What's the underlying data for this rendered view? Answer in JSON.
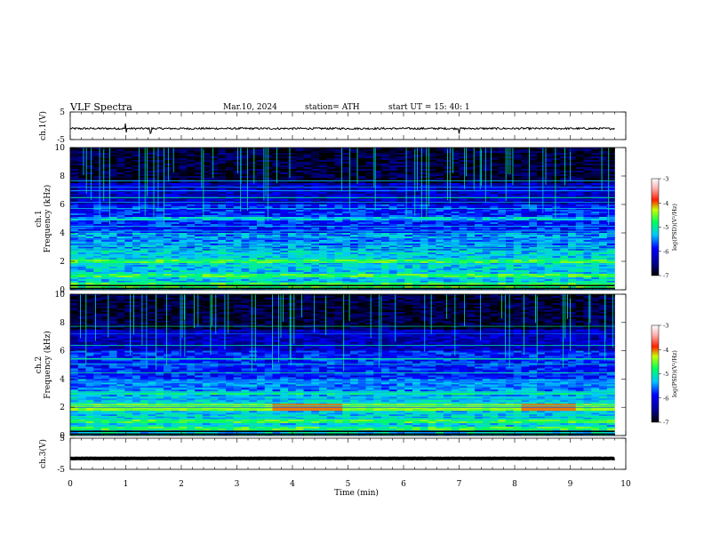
{
  "header": {
    "title": "VLF  Spectra",
    "date": "Mar.10, 2024",
    "station": "station= ATH",
    "start": "start  UT  =   15: 40: 1"
  },
  "chart_data": [
    {
      "type": "line",
      "name": "ch1-waveform",
      "ylabel": "ch.1(V)",
      "ylim": [
        -5,
        5
      ],
      "yticks": [
        "5",
        "-5"
      ],
      "baseline_v": -1.0,
      "noise_amp_v": 0.35,
      "spikes_min": [
        1.0,
        1.45,
        7.0
      ]
    },
    {
      "type": "heatmap",
      "name": "ch1-spectrogram",
      "ylabel": "ch.1\nFrequency  (kHz)",
      "ylim": [
        0,
        10
      ],
      "yticks": [
        "10",
        "8",
        "6",
        "4",
        "2",
        "0"
      ],
      "xlim": [
        0,
        10
      ],
      "data_extent_min": 9.8,
      "colorbar": {
        "label": "log(PSD)(V²/Hz)",
        "range": [
          -7,
          -3
        ],
        "ticks": [
          "-3",
          "-4",
          "-5",
          "-6",
          "-7"
        ]
      },
      "dominant_bands_khz": [
        0.3,
        1.0,
        2.0,
        5.0
      ],
      "strong_band_khz": null
    },
    {
      "type": "heatmap",
      "name": "ch2-spectrogram",
      "ylabel": "ch.2\nFrequency  (kHz)",
      "ylim": [
        0,
        10
      ],
      "yticks": [
        "10",
        "8",
        "6",
        "4",
        "2",
        "0"
      ],
      "xlim": [
        0,
        10
      ],
      "data_extent_min": 9.8,
      "colorbar": {
        "label": "log(PSD)(V²/Hz)",
        "range": [
          -7,
          -3
        ],
        "ticks": [
          "-3",
          "-4",
          "-5",
          "-6",
          "-7"
        ]
      },
      "dominant_bands_khz": [
        0.5,
        1.0,
        2.0,
        3.0
      ],
      "strong_band_khz": 2.0,
      "strong_band_segments_min": [
        [
          3.6,
          4.9
        ],
        [
          8.1,
          9.1
        ]
      ]
    },
    {
      "type": "line",
      "name": "ch3-waveform",
      "ylabel": "ch.3(V)",
      "ylim": [
        -5,
        5
      ],
      "yticks": [
        "5",
        "-5"
      ],
      "baseline_v": -1.5,
      "noise_amp_v": 0.05,
      "spikes_min": []
    }
  ],
  "xaxis": {
    "label": "Time  (min)",
    "ticks": [
      "0",
      "1",
      "2",
      "3",
      "4",
      "5",
      "6",
      "7",
      "8",
      "9",
      "10"
    ]
  },
  "colors": {
    "background": "#ffffff",
    "plot_bg_low": "#000000",
    "colormap": [
      "#000000",
      "#000080",
      "#0000ff",
      "#00c8ff",
      "#00ff80",
      "#ffff00",
      "#ff0000",
      "#ffffff"
    ]
  }
}
